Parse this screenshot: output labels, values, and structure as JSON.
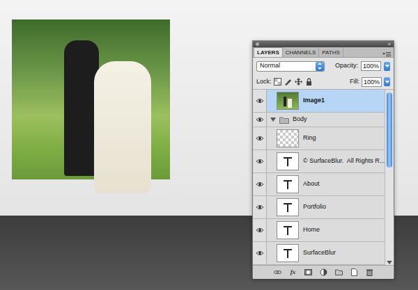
{
  "panel": {
    "collapse": "«",
    "tabs": [
      {
        "label": "LAYERS",
        "selected": true
      },
      {
        "label": "CHANNELS",
        "selected": false
      },
      {
        "label": "PATHS",
        "selected": false
      }
    ],
    "blend_mode": "Normal",
    "opacity_label": "Opacity:",
    "opacity": "100%",
    "lock_label": "Lock:",
    "fill_label": "Fill:",
    "fill": "100%",
    "layers": [
      {
        "name": "Image1",
        "kind": "image",
        "visible": true,
        "selected": true
      },
      {
        "name": "Body",
        "kind": "group",
        "visible": true,
        "selected": false,
        "expanded": true
      },
      {
        "name": "Ring",
        "kind": "raster",
        "visible": true,
        "selected": false
      },
      {
        "name": "© SurfaceBlur.  All Rights R...",
        "kind": "text",
        "visible": true,
        "selected": false
      },
      {
        "name": "About",
        "kind": "text",
        "visible": true,
        "selected": false
      },
      {
        "name": "Portfolio",
        "kind": "text",
        "visible": true,
        "selected": false
      },
      {
        "name": "Home",
        "kind": "text",
        "visible": true,
        "selected": false
      },
      {
        "name": "SurfaceBlur",
        "kind": "text",
        "visible": true,
        "selected": false
      }
    ],
    "fx_label": "fx"
  }
}
